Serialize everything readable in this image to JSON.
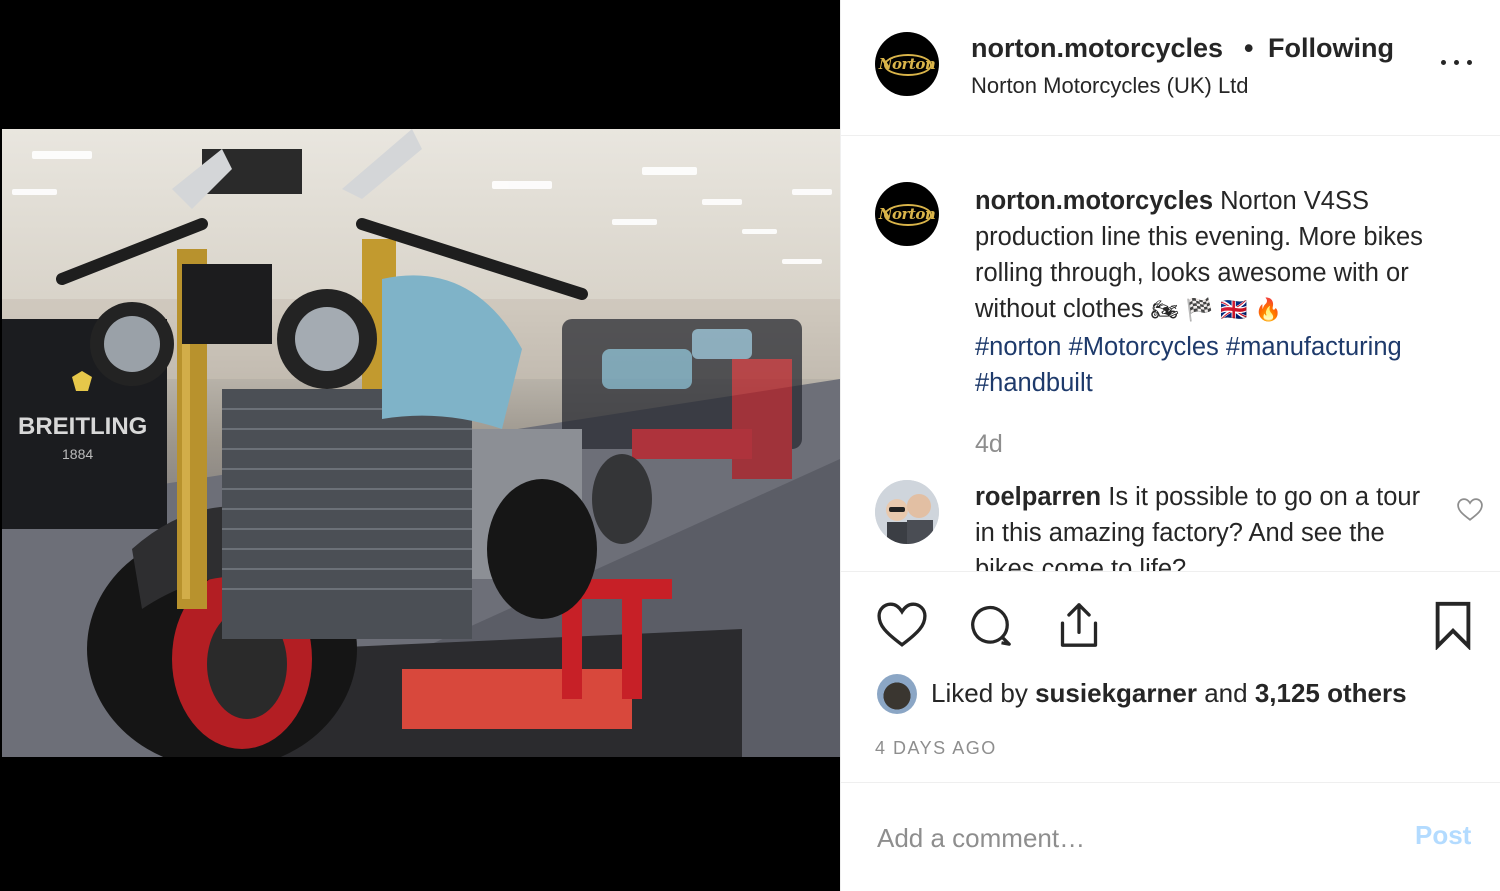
{
  "post": {
    "brand_logo_text": "Norton",
    "photo_sign_text": "BREITLING",
    "photo_sign_year": "1884"
  },
  "header": {
    "username": "norton.motorcycles",
    "separator": "•",
    "follow_label": "Following",
    "subtitle": "Norton Motorcycles (UK) Ltd",
    "more_icon": "more-horizontal-icon"
  },
  "caption": {
    "username": "norton.motorcycles",
    "text": "Norton V4SS production line this evening. More bikes rolling through, looks awesome with or without clothes",
    "emojis": "🏍 🏁 🇬🇧 🔥",
    "hashtags": [
      "#norton",
      "#Motorcycles",
      "#manufacturing",
      "#handbuilt"
    ],
    "age": "4d"
  },
  "comment": {
    "username": "roelparren",
    "text": "Is it possible to go on a tour in this amazing factory? And",
    "text_cut": "see the bikes come to life?"
  },
  "actions": {
    "like_icon": "heart-icon",
    "comment_icon": "comment-bubble-icon",
    "share_icon": "share-icon",
    "save_icon": "bookmark-icon"
  },
  "likes": {
    "prefix": "Liked by",
    "user": "susiekgarner",
    "joiner": "and",
    "others": "3,125 others"
  },
  "date_label": "4 DAYS AGO",
  "add_comment": {
    "placeholder": "Add a comment…",
    "post_label": "Post"
  },
  "colors": {
    "hashtag": "#1e3a6b",
    "post_button_disabled": "#b3dbff",
    "muted": "#8e8e8e",
    "text": "#262626"
  }
}
